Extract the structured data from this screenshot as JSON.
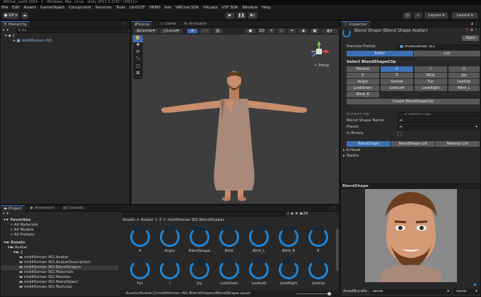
{
  "window_title": "VRChat_LastR 2024 - 1 - Windows, Mac, Linux - Unity 2022.3.22f1* <DX11>",
  "menu": [
    "File",
    "Edit",
    "Assets",
    "GameObject",
    "Component",
    "Services",
    "Tools",
    "UniGLTF",
    "VRM0",
    "lolo",
    "VRChat SDK",
    "VRLabs",
    "VSF SDK",
    "Window",
    "Help"
  ],
  "toolbar": {
    "account": "GP",
    "layers": "Layers",
    "layout": "Layout"
  },
  "hierarchy": {
    "tab": "Hierarchy",
    "search_placeholder": "All",
    "scene": "1",
    "item": "mid40sman W2"
  },
  "scene": {
    "tabs": [
      "Scene",
      "Game",
      "Animator"
    ],
    "pivot": "Center",
    "space": "Local",
    "persp_label": "< Persp"
  },
  "inspector": {
    "tab": "Inspector",
    "title": "Blend Shape (Blend Shape Avatar)",
    "open_button": "Open",
    "preview_prefab_label": "Preview Prefab",
    "preview_prefab_value": "mid40sman W2",
    "mode_tabs": [
      "Editor",
      "List"
    ],
    "select_label": "Select BlendShapeClip",
    "clips": [
      "Neutral",
      "A",
      "I",
      "U",
      "E",
      "O",
      "Blink",
      "Joy",
      "Angry",
      "Sorrow",
      "Fun",
      "LookUp",
      "LookDown",
      "LookLeft",
      "LookRight",
      "Blink_L",
      "Blink_R"
    ],
    "selected_clip": "A",
    "create_button": "Create BlendShapeClip",
    "current_clip_label": "Current clip",
    "current_clip_value": "A (Blend Clip)",
    "blend_shape_name_label": "Blend Shape Name",
    "blend_shape_name_value": "A",
    "preset_label": "Preset",
    "preset_value": "A",
    "is_binary_label": "Is Binary",
    "subtabs": [
      "BlendShape",
      "BlendShape List",
      "Material List"
    ],
    "foldouts": [
      "A.Head",
      "Teeths"
    ],
    "preview_label": "BlendShape",
    "assetbundle_label": "AssetBundle",
    "assetbundle_value": "None",
    "assetbundle_variant": "None"
  },
  "project": {
    "tabs": [
      "Project",
      "Animation",
      "Console"
    ],
    "favorites_label": "Favorites",
    "favorites": [
      "All Materials",
      "All Models",
      "All Prefabs"
    ],
    "assets_label": "Assets",
    "tree": [
      "Avatar",
      "2",
      "mid40sman W2.Avatar",
      "mid40sman W2.AvatarDescription",
      "mid40sman W2.BlendShapes",
      "mid40sman W2.Materials",
      "mid40sman W2.Meshes",
      "mid40sman W2.MetaObject",
      "mid40sman W2.Textures"
    ],
    "breadcrumb": [
      "Assets",
      "Avatar",
      "2",
      "mid40sman W2.BlendShapes"
    ],
    "assets": [
      "A",
      "Angry",
      "BlendShape",
      "Blink",
      "Blink_L",
      "Blink_R",
      "E",
      "Fun",
      "I",
      "Joy",
      "LookDown",
      "LookLeft",
      "LookRight",
      "LookUp"
    ],
    "footer_path": "Assets/Avatar/2/mid40sman W2.BlendShapes/BlendShape.asset",
    "item_count": "28"
  },
  "colors": {
    "accent": "#3d6fb3",
    "asset_ring": "#1d86d8",
    "panel": "#282828",
    "scene_bg": "#3d3d3d"
  }
}
